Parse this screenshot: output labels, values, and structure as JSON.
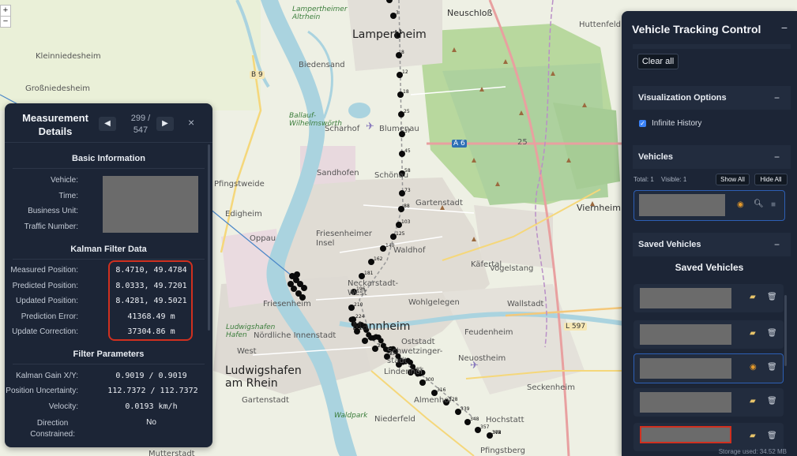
{
  "map": {
    "zoom_in": "+",
    "zoom_out": "−",
    "labels": {
      "lampertheim": "Lampertheim",
      "lampertheimer_altrhein": "Lampertheimer\nAltrhein",
      "neuschloss": "Neuschloß",
      "huttenfeld": "Huttenfeld",
      "kleinniedesheim": "Kleinniedesheim",
      "grossniedesheim": "Großniedesheim",
      "biedensand": "Biedensand",
      "ballauf": "Ballauf-\nWilhelmswörth",
      "scharhof": "Scharhof",
      "blumenau": "Blumenau",
      "sandhofen": "Sandhofen",
      "schoenau": "Schönau",
      "gartenstadt": "Gartenstadt",
      "viernheim": "Viernheim",
      "pfingstweide": "Pfingstweide",
      "edigheim": "Edigheim",
      "oppau": "Oppau",
      "friesenheimer_insel": "Friesenheimer\nInsel",
      "waldhof": "Waldhof",
      "kaefertal": "Käfertal",
      "vogelstang": "Vogelstang",
      "neckarstadt_west": "Neckarstadt-\nWest",
      "wohlgelegen": "Wohlgelegen",
      "wallstadt": "Wallstadt",
      "friesenheim": "Friesenheim",
      "mannheim": "Mannheim",
      "oststadt": "Oststadt",
      "feudenheim": "Feudenheim",
      "nord_innenstadt": "Nördliche Innenstadt",
      "west": "West",
      "schwetzingerstadt": "Schwetzinger-\nstadt",
      "ludwigshafen": "Ludwigshafen\nam Rhein",
      "neuostheim": "Neuostheim",
      "lindenhof": "Lindenhof",
      "seckenheim": "Seckenheim",
      "niederfeld": "Niederfeld",
      "almenhof": "Almenhof",
      "hochstatt": "Hochstatt",
      "gartenstadt2": "Gartenstadt",
      "pfingstberg": "Pfingstberg",
      "waldpark": "Waldpark",
      "b9": "B 9",
      "a6": "A 6",
      "l597": "L 597",
      "road_25": "25",
      "ludwigshafen_hafen": "Ludwigshafen\nHafen",
      "mutterstadt": "Mutterstadt"
    },
    "track_numbers": [
      "2",
      "3",
      "5",
      "8",
      "12",
      "18",
      "25",
      "37",
      "45",
      "58",
      "73",
      "88",
      "103",
      "125",
      "140",
      "162",
      "181",
      "196",
      "210",
      "224",
      "238",
      "252",
      "262",
      "271",
      "279",
      "285",
      "300",
      "316",
      "328",
      "339",
      "348",
      "357",
      "365",
      "372",
      "378"
    ]
  },
  "measurement": {
    "title": "Measurement\nDetails",
    "prev_icon": "◀",
    "next_icon": "▶",
    "count": "299 /\n547",
    "close_icon": "×",
    "basic_info_title": "Basic Information",
    "basic": [
      {
        "label": "Vehicle:"
      },
      {
        "label": "Time:"
      },
      {
        "label": "Business Unit:"
      },
      {
        "label": "Traffic Number:"
      }
    ],
    "kalman_title": "Kalman Filter Data",
    "kalman": [
      {
        "label": "Measured Position:",
        "value": "8.4710, 49.4784"
      },
      {
        "label": "Predicted Position:",
        "value": "8.0333, 49.7201"
      },
      {
        "label": "Updated Position:",
        "value": "8.4281, 49.5021"
      },
      {
        "label": "Prediction Error:",
        "value": "41368.49 m"
      },
      {
        "label": "Update Correction:",
        "value": "37304.86 m"
      }
    ],
    "filter_title": "Filter Parameters",
    "filter": [
      {
        "label": "Kalman Gain X/Y:",
        "value": "0.9019 / 0.9019"
      },
      {
        "label": "Position Uncertainty:",
        "value": "112.7372 / 112.7372"
      },
      {
        "label": "Velocity:",
        "value": "0.0193 km/h"
      },
      {
        "label": "Direction\nConstrained:",
        "value": "No"
      }
    ]
  },
  "tracking": {
    "title": "Vehicle Tracking Control",
    "minimize": "−",
    "clear_all": "Clear all",
    "visualization_title": "Visualization Options",
    "infinite_history": "Infinite History",
    "vehicles_title": "Vehicles",
    "total": "Total: 1",
    "visible": "Visible: 1",
    "show_all": "Show All",
    "hide_all": "Hide All",
    "saved_title": "Saved Vehicles",
    "saved_heading": "Saved Vehicles",
    "storage": "Storage used: 34.52 MB"
  },
  "colors": {
    "panel_bg": "#1c2536",
    "accent_blue": "#2d5fb5",
    "highlight_red": "#d0301f",
    "map_water": "#aad3df",
    "map_forest": "#add19e"
  }
}
